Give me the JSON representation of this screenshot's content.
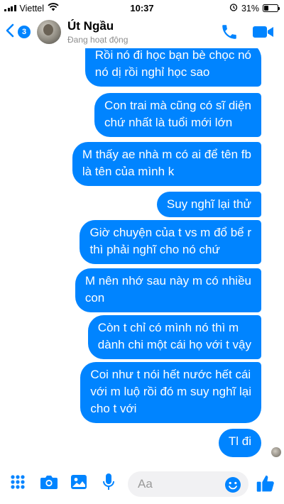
{
  "status_bar": {
    "carrier": "Viettel",
    "time": "10:37",
    "battery_percent": "31%",
    "battery_level": 0.31,
    "icons": [
      "signal-icon",
      "wifi-icon",
      "alarm-icon",
      "battery-icon"
    ]
  },
  "header": {
    "unread_count": "3",
    "contact_name": "Út Ngầu",
    "contact_status": "Đang hoạt động",
    "icons": [
      "back-chevron-icon",
      "phone-icon",
      "video-camera-icon"
    ]
  },
  "colors": {
    "accent": "#0084ff",
    "bubble_text": "#ffffff",
    "background": "#ffffff",
    "status_gray": "#8d8d8d",
    "input_bg": "#f1f1f3"
  },
  "messages": [
    {
      "sender": "me",
      "text": "Rồi nó đi học bạn bè chọc nó\nnó dị rồi nghỉ học sao"
    },
    {
      "sender": "me",
      "text": "Con trai mà cũng có sĩ diện\nchứ nhất là tuổi mới lớn"
    },
    {
      "sender": "me",
      "text": "M thấy ae nhà m có ai để tên fb\nlà tên của mình k"
    },
    {
      "sender": "me",
      "text": "Suy nghĩ lại thử"
    },
    {
      "sender": "me",
      "text": "Giờ chuyện của t vs m đổ bể r\nthì phải nghĩ cho nó chứ"
    },
    {
      "sender": "me",
      "text": "M nên nhớ sau này m có nhiều\ncon"
    },
    {
      "sender": "me",
      "text": "Còn t chỉ có mình nó thì m\ndành chi một cái họ với t vậy"
    },
    {
      "sender": "me",
      "text": "Coi như t nói hết nước hết cái\nvới m luộ rồi đó m suy nghĩ lại\ncho t với"
    },
    {
      "sender": "me",
      "text": "Tl đi"
    }
  ],
  "composer": {
    "placeholder": "Aa",
    "icons": [
      "apps-grid-icon",
      "camera-icon",
      "photo-icon",
      "microphone-icon",
      "emoji-icon",
      "thumbs-up-icon"
    ]
  }
}
